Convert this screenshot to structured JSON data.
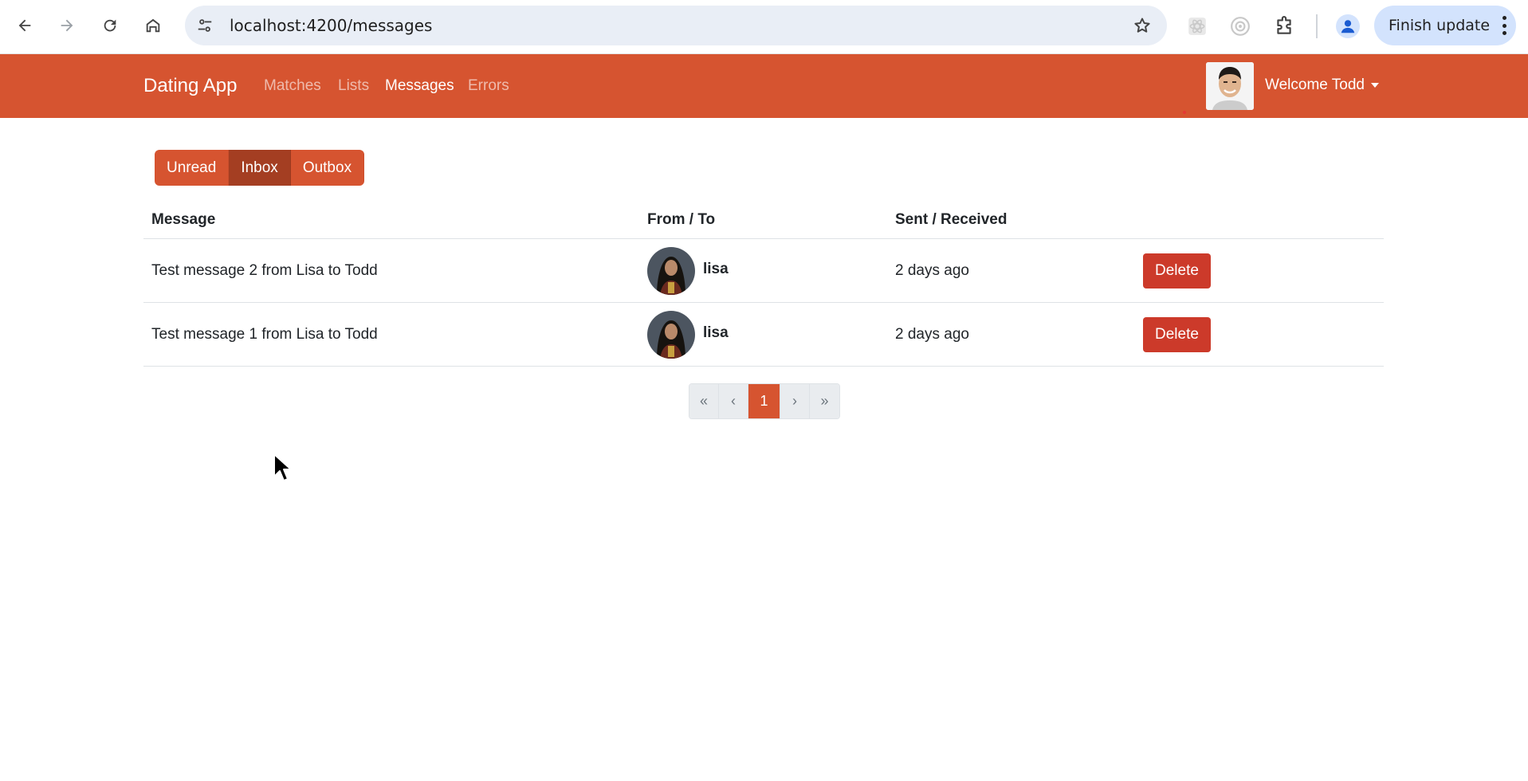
{
  "browser": {
    "url": "localhost:4200/messages",
    "update_label": "Finish update"
  },
  "navbar": {
    "brand": "Dating App",
    "links": [
      {
        "label": "Matches",
        "active": false
      },
      {
        "label": "Lists",
        "active": false
      },
      {
        "label": "Messages",
        "active": true
      },
      {
        "label": "Errors",
        "active": false
      }
    ],
    "welcome": "Welcome Todd"
  },
  "tabs": [
    {
      "label": "Unread",
      "active": false
    },
    {
      "label": "Inbox",
      "active": true
    },
    {
      "label": "Outbox",
      "active": false
    }
  ],
  "table": {
    "headers": [
      "Message",
      "From / To",
      "Sent / Received",
      ""
    ],
    "rows": [
      {
        "message": "Test message 2 from Lisa to Todd",
        "user": "lisa",
        "time": "2 days ago",
        "action": "Delete"
      },
      {
        "message": "Test message 1 from Lisa to Todd",
        "user": "lisa",
        "time": "2 days ago",
        "action": "Delete"
      }
    ]
  },
  "pagination": {
    "first": "«",
    "prev": "‹",
    "current": "1",
    "next": "›",
    "last": "»"
  },
  "colors": {
    "primary": "#d65430",
    "active_tab": "#a43e22",
    "danger": "#cc3a2a"
  }
}
